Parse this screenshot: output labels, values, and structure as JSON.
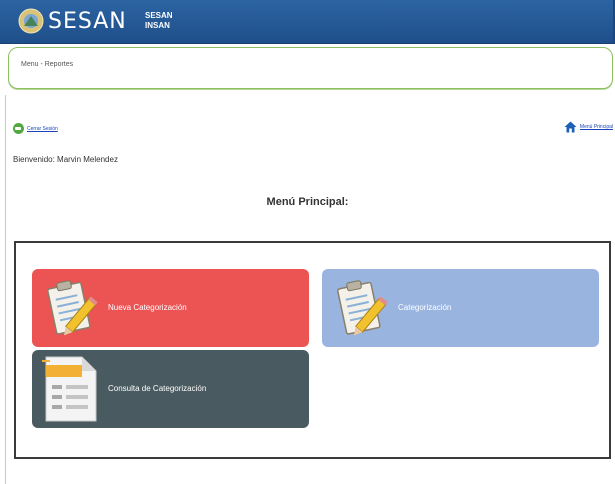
{
  "header": {
    "logo_text": "SESAN",
    "sub_brand_line1": "SESAN",
    "sub_brand_line2": "INSAN"
  },
  "breadcrumb": {
    "text": "Menu - Reportes"
  },
  "links": {
    "back_label": "Cerrar Sesión",
    "home_label": "Menú Principal"
  },
  "welcome": {
    "text": "Bienvenido: Marvin Melendez"
  },
  "menu": {
    "title": "Menú Principal:",
    "tiles": [
      {
        "label": "Nueva Categorización",
        "color": "#ec5454",
        "icon": "clipboard-pencil-icon"
      },
      {
        "label": "Categorización",
        "color": "#9ab4e0",
        "icon": "clipboard-pencil-icon"
      },
      {
        "label": "Consulta de Categorización",
        "color": "#495a61",
        "icon": "document-icon"
      }
    ]
  },
  "colors": {
    "header": "#2c64a3",
    "crumb_border": "#8cc05f",
    "link": "#1a44b8"
  }
}
